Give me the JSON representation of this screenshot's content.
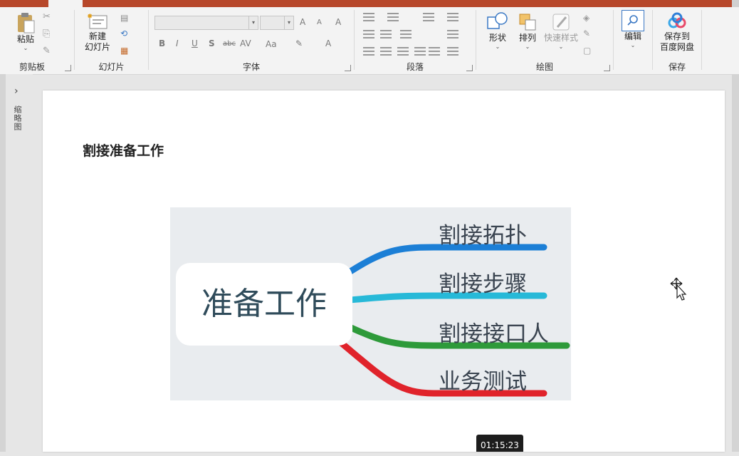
{
  "ribbon": {
    "clipboard": {
      "paste_label": "粘贴",
      "group_label": "剪贴板"
    },
    "slides": {
      "new_slide_label": "新建",
      "new_slide_label2": "幻灯片",
      "group_label": "幻灯片"
    },
    "font": {
      "group_label": "字体",
      "bold": "B",
      "italic": "I",
      "underline": "U",
      "shadow": "S",
      "strike": "abc",
      "spacing": "AV",
      "case": "Aa",
      "font_color": "A"
    },
    "paragraph": {
      "group_label": "段落"
    },
    "drawing": {
      "shapes_label": "形状",
      "arrange_label": "排列",
      "quick_styles_label": "快速样式",
      "group_label": "绘图"
    },
    "editing": {
      "label": "编辑"
    },
    "save": {
      "label_line1": "保存到",
      "label_line2": "百度网盘",
      "group_label": "保存"
    }
  },
  "left_panel": {
    "label": "缩略图"
  },
  "slide": {
    "title": "割接准备工作",
    "mindmap": {
      "center": "准备工作",
      "branches": [
        {
          "label": "割接拓扑",
          "color": "#1c7fd6"
        },
        {
          "label": "割接步骤",
          "color": "#27b9d8"
        },
        {
          "label": "割接接口人",
          "color": "#2e9a3a"
        },
        {
          "label": "业务测试",
          "color": "#e0232b"
        }
      ]
    }
  },
  "video": {
    "timestamp": "01:15:23"
  }
}
